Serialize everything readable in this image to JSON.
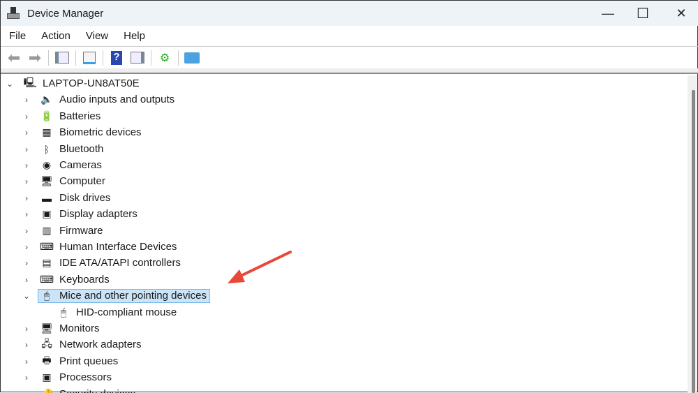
{
  "window": {
    "title": "Device Manager",
    "minimize": "—",
    "maximize": "☐",
    "close": "✕"
  },
  "menu": [
    "File",
    "Action",
    "View",
    "Help"
  ],
  "toolbar": [
    "back-icon",
    "forward-icon",
    "show-hide-console-tree-icon",
    "properties-icon",
    "help-icon",
    "show-action-pane-icon",
    "update-driver-icon",
    "scan-hardware-icon"
  ],
  "tree": {
    "root": "LAPTOP-UN8AT50E",
    "categories": [
      {
        "label": "Audio inputs and outputs",
        "icon": "🔈"
      },
      {
        "label": "Batteries",
        "icon": "🔋"
      },
      {
        "label": "Biometric devices",
        "icon": "▦"
      },
      {
        "label": "Bluetooth",
        "icon": "ᛒ"
      },
      {
        "label": "Cameras",
        "icon": "◉"
      },
      {
        "label": "Computer",
        "icon": "🖥"
      },
      {
        "label": "Disk drives",
        "icon": "▬"
      },
      {
        "label": "Display adapters",
        "icon": "▣"
      },
      {
        "label": "Firmware",
        "icon": "▥"
      },
      {
        "label": "Human Interface Devices",
        "icon": "⌨"
      },
      {
        "label": "IDE ATA/ATAPI controllers",
        "icon": "▤"
      },
      {
        "label": "Keyboards",
        "icon": "⌨"
      },
      {
        "label": "Mice and other pointing devices",
        "icon": "🖱",
        "expanded": true,
        "selected": true,
        "children": [
          "HID-compliant mouse"
        ]
      },
      {
        "label": "Monitors",
        "icon": "🖥"
      },
      {
        "label": "Network adapters",
        "icon": "🖧"
      },
      {
        "label": "Print queues",
        "icon": "🖶"
      },
      {
        "label": "Processors",
        "icon": "▣"
      },
      {
        "label": "Security devices",
        "icon": "🔑"
      }
    ]
  },
  "colors": {
    "selection": "#cce4f7",
    "arrow": "#e8473a"
  }
}
